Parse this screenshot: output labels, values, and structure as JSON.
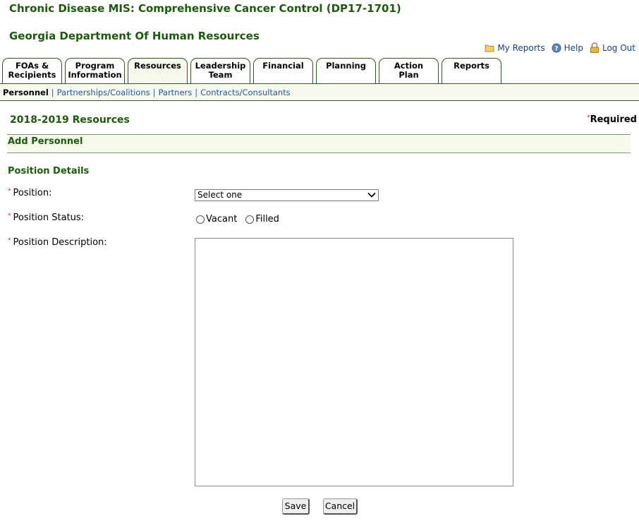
{
  "header": {
    "app_title": "Chronic Disease MIS: Comprehensive Cancer Control (DP17-1701)",
    "org_title": "Georgia Department Of Human Resources"
  },
  "toplinks": {
    "my_reports": "My Reports",
    "help": "Help",
    "log_out": "Log Out"
  },
  "tabs": [
    {
      "line1": "FOAs &",
      "line2": "Recipients"
    },
    {
      "line1": "Program",
      "line2": "Information"
    },
    {
      "line1": "Resources",
      "line2": ""
    },
    {
      "line1": "Leadership",
      "line2": "Team"
    },
    {
      "line1": "Financial",
      "line2": ""
    },
    {
      "line1": "Planning",
      "line2": ""
    },
    {
      "line1": "Action",
      "line2": "Plan"
    },
    {
      "line1": "Reports",
      "line2": ""
    }
  ],
  "subnav": {
    "current": "Personnel",
    "links": [
      "Partnerships/Coalitions",
      "Partners",
      "Contracts/Consultants"
    ]
  },
  "page": {
    "section_title": "2018-2019 Resources",
    "required_star": "*",
    "required_label": "Required",
    "add_title": "Add Personnel",
    "details_title": "Position Details"
  },
  "form": {
    "position_label": "Position:",
    "position_value": "Select one",
    "status_label": "Position Status:",
    "status_options": [
      "Vacant",
      "Filled"
    ],
    "description_label": "Position Description:",
    "description_value": ""
  },
  "buttons": {
    "save": "Save",
    "cancel": "Cancel"
  },
  "colors": {
    "heading_green": "#1c5a0e",
    "link_blue": "#2a55a5",
    "required_red": "#d22"
  }
}
